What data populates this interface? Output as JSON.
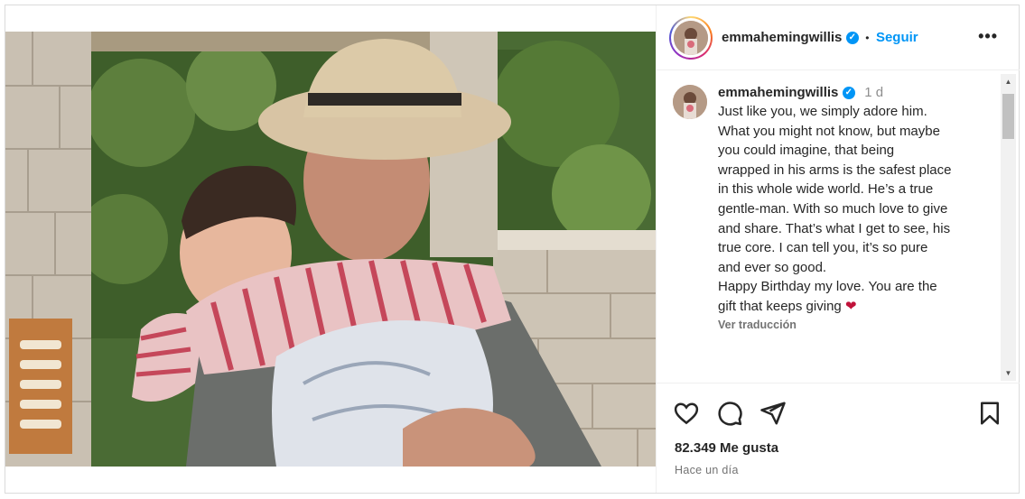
{
  "post": {
    "username": "emmahemingwillis",
    "verified_badge": "✓",
    "follow_label": "Seguir",
    "separator": "•",
    "more_icon": "more-horizontal-icon",
    "more_label": "•••"
  },
  "caption": {
    "username": "emmahemingwillis",
    "time": "1 d",
    "text": "Just like you, we simply adore him.\nWhat you might not know, but maybe\nyou could imagine, that being\nwrapped in his arms is the safest place\nin this whole wide world. He’s a true\ngentle-man. With so much love to give\nand share. That’s what I get to see, his\ntrue core. I can tell you, it’s so pure\nand ever so good.\nHappy Birthday my love. You are the\ngift that keeps giving",
    "emoji": "❤",
    "translate_label": "Ver traducción"
  },
  "actions": {
    "like_icon": "heart-icon",
    "comment_icon": "comment-icon",
    "share_icon": "send-icon",
    "save_icon": "bookmark-icon",
    "likes_text": "82.349 Me gusta",
    "time_ago": "Hace un día"
  },
  "scrollbar": {
    "up_arrow": "▲",
    "down_arrow": "▼"
  },
  "colors": {
    "accent": "#0095f6",
    "text": "#262626",
    "muted": "#737373",
    "border": "#dbdbdb"
  }
}
